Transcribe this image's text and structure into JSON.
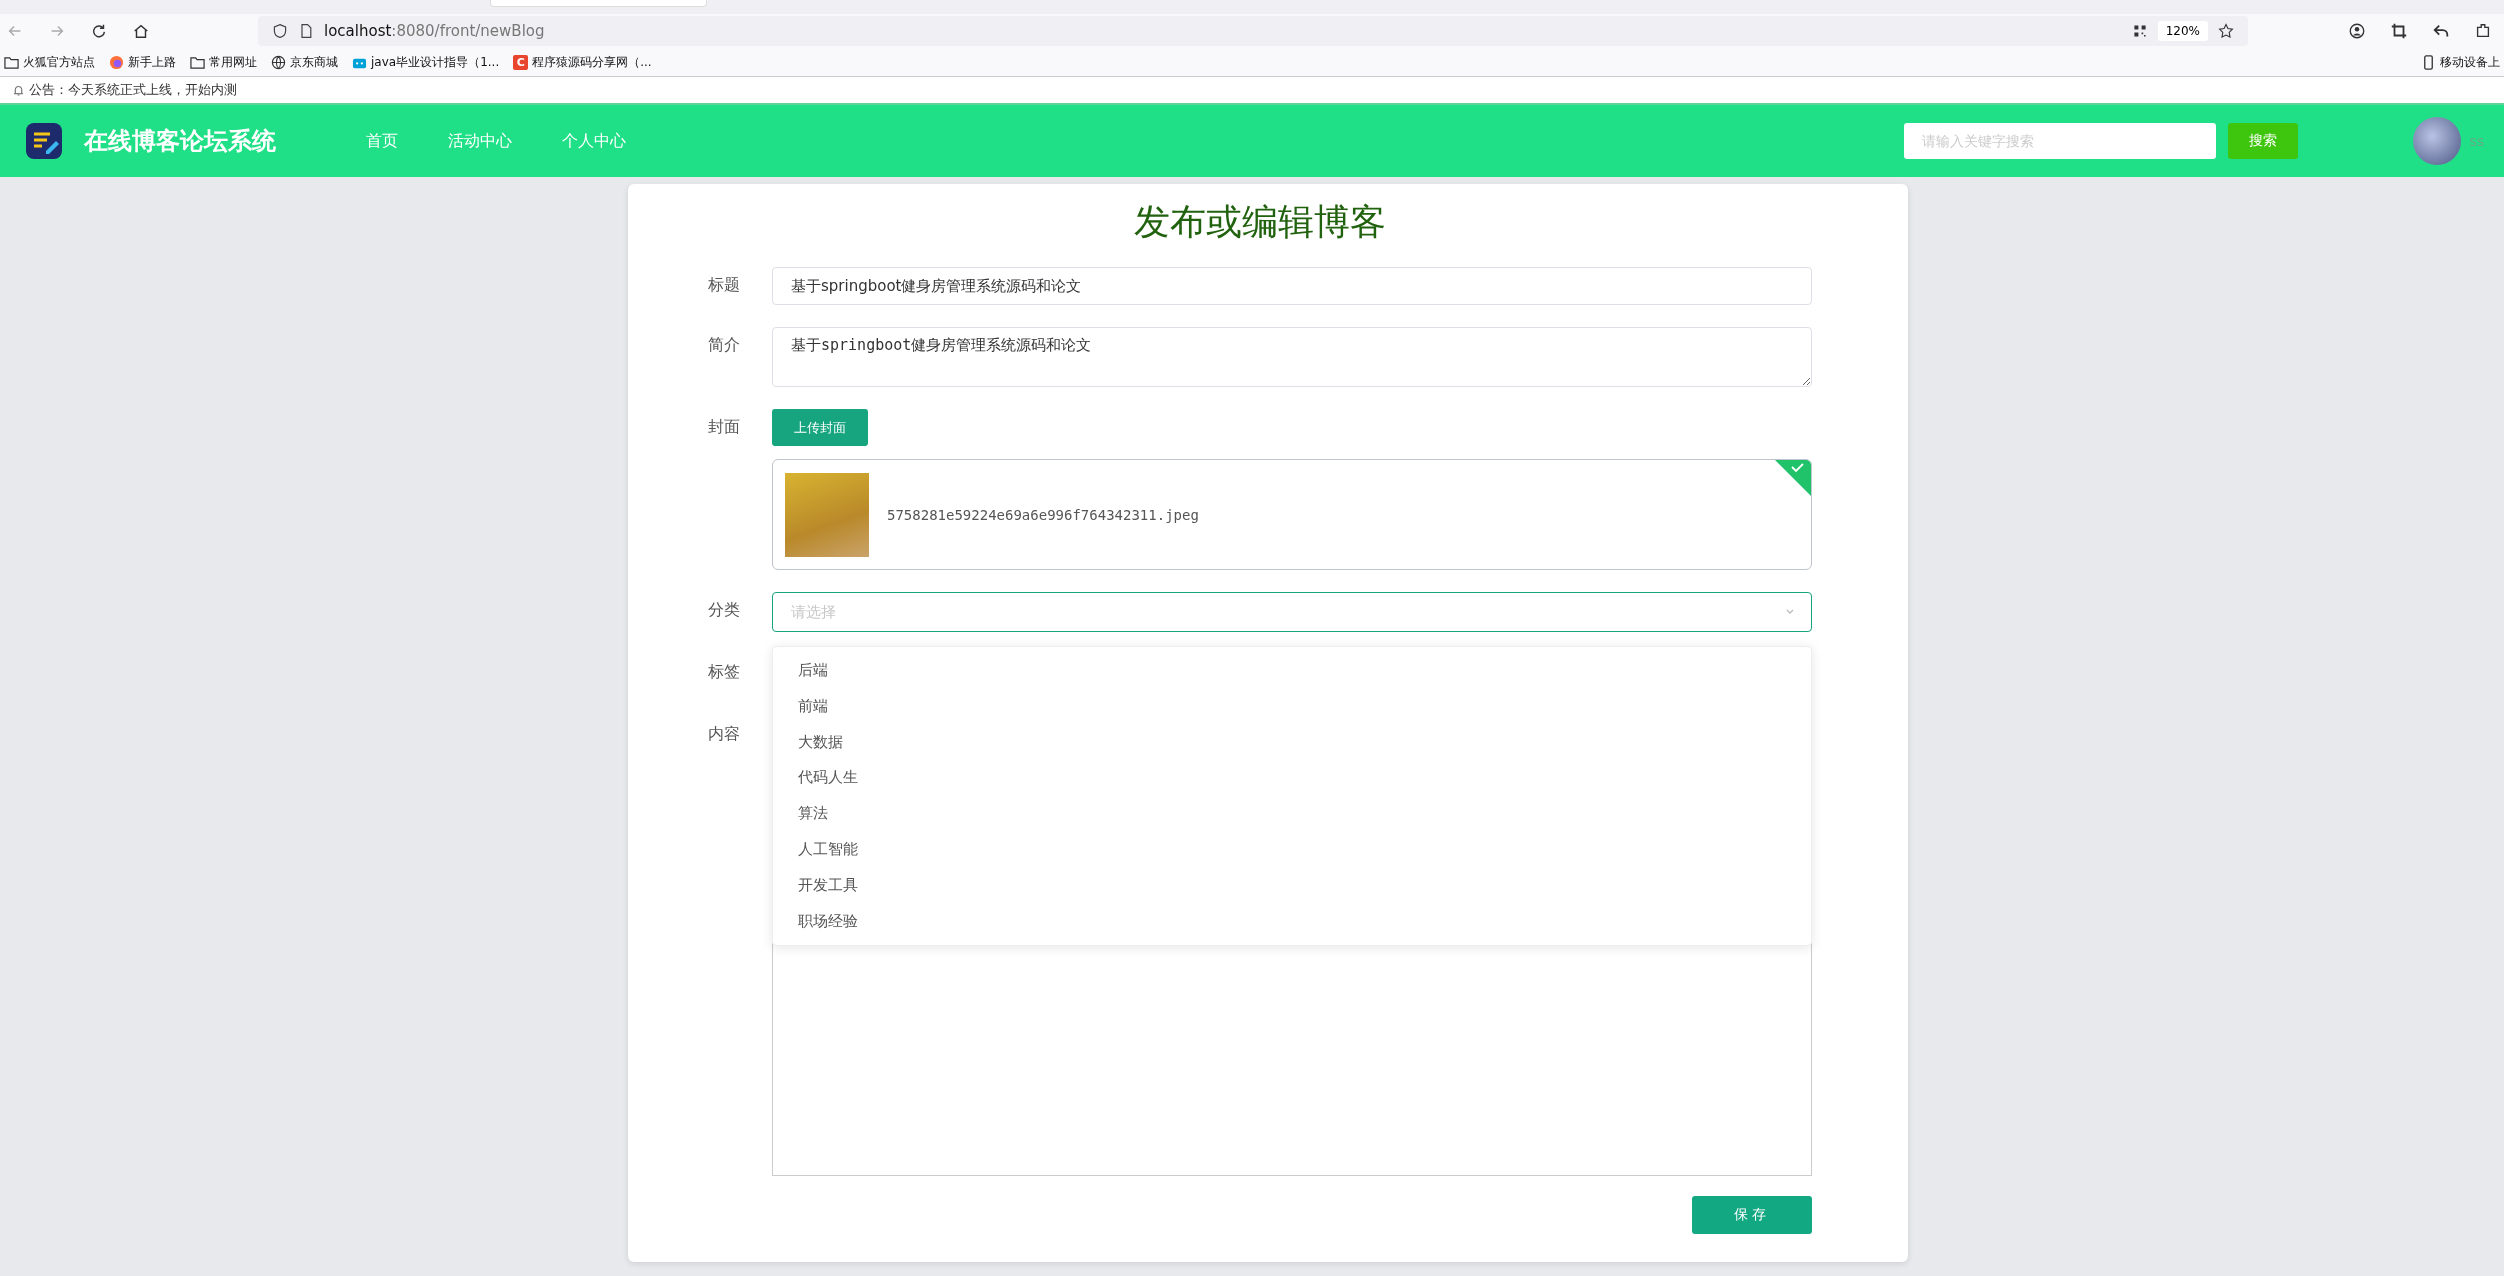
{
  "browser": {
    "url_host": "localhost",
    "url_path": ":8080/front/newBlog",
    "zoom": "120%",
    "bookmarks": [
      {
        "label": "火狐官方站点",
        "kind": "folder"
      },
      {
        "label": "新手上路",
        "kind": "firefox"
      },
      {
        "label": "常用网址",
        "kind": "folder"
      },
      {
        "label": "京东商城",
        "kind": "globe"
      },
      {
        "label": "java毕业设计指导（1...",
        "kind": "tv"
      },
      {
        "label": "程序猿源码分享网（...",
        "kind": "letter",
        "letter": "C"
      }
    ],
    "mobile_bookmarks": "移动设备上"
  },
  "notice": "公告：今天系统正式上线，开始内测",
  "header": {
    "site_name": "在线博客论坛系统",
    "nav": [
      {
        "label": "首页"
      },
      {
        "label": "活动中心"
      },
      {
        "label": "个人中心"
      }
    ],
    "search": {
      "placeholder": "请输入关键字搜索"
    },
    "search_button": "搜索",
    "username": "ss"
  },
  "form": {
    "heading": "发布或编辑博客",
    "title": {
      "label": "标题",
      "value": "基于springboot健身房管理系统源码和论文"
    },
    "intro": {
      "label": "简介",
      "value": "基于springboot健身房管理系统源码和论文"
    },
    "cover": {
      "label": "封面",
      "upload_button": "上传封面",
      "file_name": "5758281e59224e69a6e996f764342311.jpeg",
      "uploaded": true
    },
    "category": {
      "label": "分类",
      "placeholder": "请选择",
      "focused": true,
      "expanded": true,
      "options": [
        {
          "label": "后端",
          "selected": false
        },
        {
          "label": "前端",
          "selected": false
        },
        {
          "label": "大数据",
          "selected": false
        },
        {
          "label": "代码人生",
          "selected": false
        },
        {
          "label": "算法",
          "selected": false
        },
        {
          "label": "人工智能",
          "selected": false
        },
        {
          "label": "开发工具",
          "selected": false
        },
        {
          "label": "职场经验",
          "selected": false
        }
      ]
    },
    "tags": {
      "label": "标签"
    },
    "content": {
      "label": "内容"
    },
    "save_button": "保存"
  }
}
